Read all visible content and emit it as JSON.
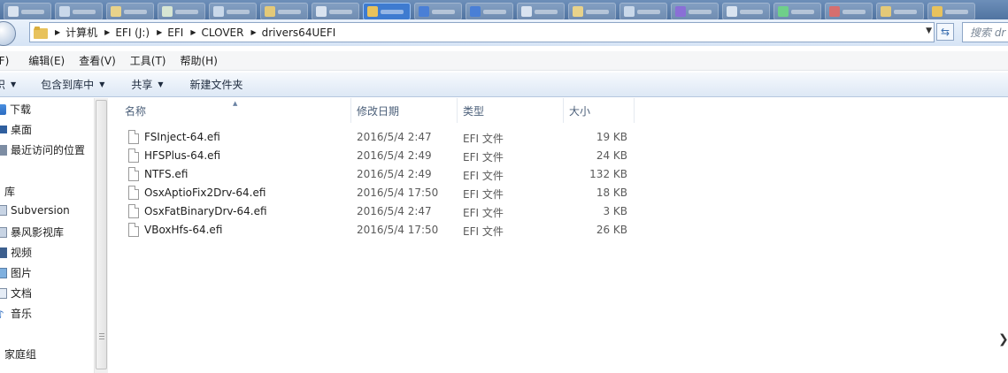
{
  "window": {
    "address": {
      "crumbs": [
        "计算机",
        "EFI (J:)",
        "EFI",
        "CLOVER",
        "drivers64UEFI"
      ],
      "search_placeholder": "搜索 dr"
    },
    "menu": [
      "(F)",
      "编辑(E)",
      "查看(V)",
      "工具(T)",
      "帮助(H)"
    ],
    "commands": {
      "organize_caret": "织",
      "include_library": "包含到库中",
      "share": "共享",
      "new_folder": "新建文件夹"
    },
    "nav": {
      "favorites": [
        "下载",
        "桌面",
        "最近访问的位置"
      ],
      "libraries_title": "库",
      "libraries": [
        "Subversion",
        "暴风影视库",
        "视频",
        "图片",
        "文档",
        "音乐"
      ],
      "homegroup": "家庭组"
    },
    "columns": {
      "name": "名称",
      "date": "修改日期",
      "type": "类型",
      "size": "大小"
    },
    "files": [
      {
        "name": "FSInject-64.efi",
        "date": "2016/5/4 2:47",
        "type": "EFI 文件",
        "size": "19 KB"
      },
      {
        "name": "HFSPlus-64.efi",
        "date": "2016/5/4 2:49",
        "type": "EFI 文件",
        "size": "24 KB"
      },
      {
        "name": "NTFS.efi",
        "date": "2016/5/4 2:49",
        "type": "EFI 文件",
        "size": "132 KB"
      },
      {
        "name": "OsxAptioFix2Drv-64.efi",
        "date": "2016/5/4 17:50",
        "type": "EFI 文件",
        "size": "18 KB"
      },
      {
        "name": "OsxFatBinaryDrv-64.efi",
        "date": "2016/5/4 2:47",
        "type": "EFI 文件",
        "size": "3 KB"
      },
      {
        "name": "VBoxHfs-64.efi",
        "date": "2016/5/4 17:50",
        "type": "EFI 文件",
        "size": "26 KB"
      }
    ]
  }
}
